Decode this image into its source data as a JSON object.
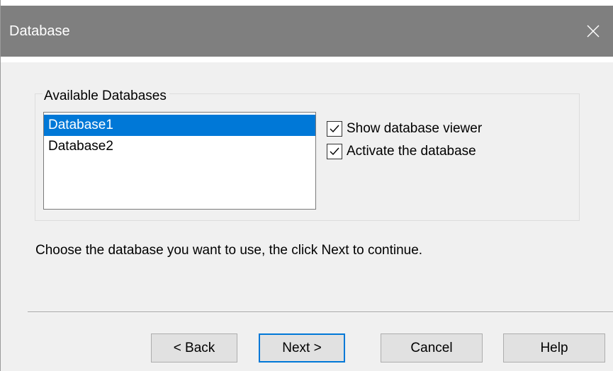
{
  "window": {
    "title": "Database",
    "close_icon": "close-icon"
  },
  "group": {
    "label": "Available Databases"
  },
  "databases": [
    {
      "name": "Database1",
      "selected": true
    },
    {
      "name": "Database2",
      "selected": false
    }
  ],
  "options": {
    "show_viewer": {
      "label": "Show database viewer",
      "checked": true
    },
    "activate": {
      "label": "Activate the database",
      "checked": true
    }
  },
  "instruction": "Choose the database you want to use, the click Next to continue.",
  "buttons": {
    "back": "< Back",
    "next": "Next >",
    "cancel": "Cancel",
    "help": "Help"
  },
  "colors": {
    "titlebar": "#7f7f7f",
    "selection": "#0078d7",
    "default_button_border": "#0078d7",
    "background": "#f0f0f0"
  }
}
